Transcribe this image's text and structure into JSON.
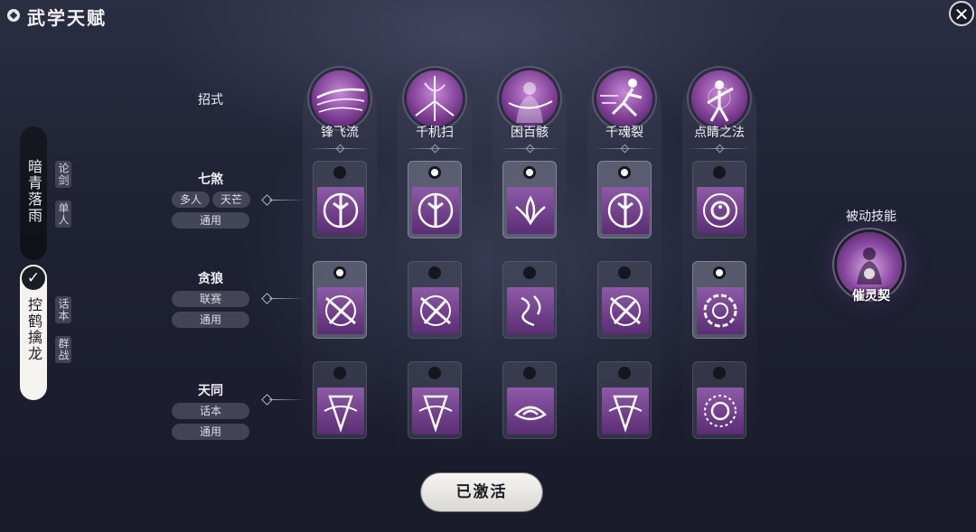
{
  "header": {
    "title": "武学天赋",
    "close_icon": "close-icon"
  },
  "characters": [
    {
      "name": "暗青落雨",
      "selected": false,
      "modes": [
        "论剑",
        "单人"
      ]
    },
    {
      "name": "控鹤擒龙",
      "selected": true,
      "modes": [
        "话本",
        "群战"
      ]
    }
  ],
  "rows": {
    "header_label": "招式",
    "talents": [
      {
        "title": "七煞",
        "tags": [
          "多人",
          "天芒",
          "通用"
        ],
        "selected_index": 4
      },
      {
        "title": "贪狼",
        "tags": [
          "联赛",
          "通用"
        ],
        "selected_index": 4
      },
      {
        "title": "天同",
        "tags": [
          "话本",
          "通用"
        ],
        "selected_index": -1
      }
    ]
  },
  "skills": [
    {
      "name": "锋飞流",
      "selections": [
        false,
        true,
        false
      ]
    },
    {
      "name": "千机扫",
      "selections": [
        true,
        false,
        false
      ]
    },
    {
      "name": "困百骸",
      "selections": [
        true,
        false,
        false
      ]
    },
    {
      "name": "千魂裂",
      "selections": [
        true,
        false,
        false
      ]
    },
    {
      "name": "点睛之法",
      "selections": [
        false,
        true,
        false
      ]
    }
  ],
  "passive": {
    "label": "被动技能",
    "name": "催灵契"
  },
  "activate_button": "已激活",
  "colors": {
    "accent_purple": "#8a4aa2",
    "background": "#1f2234",
    "button": "#f4f3f0"
  }
}
